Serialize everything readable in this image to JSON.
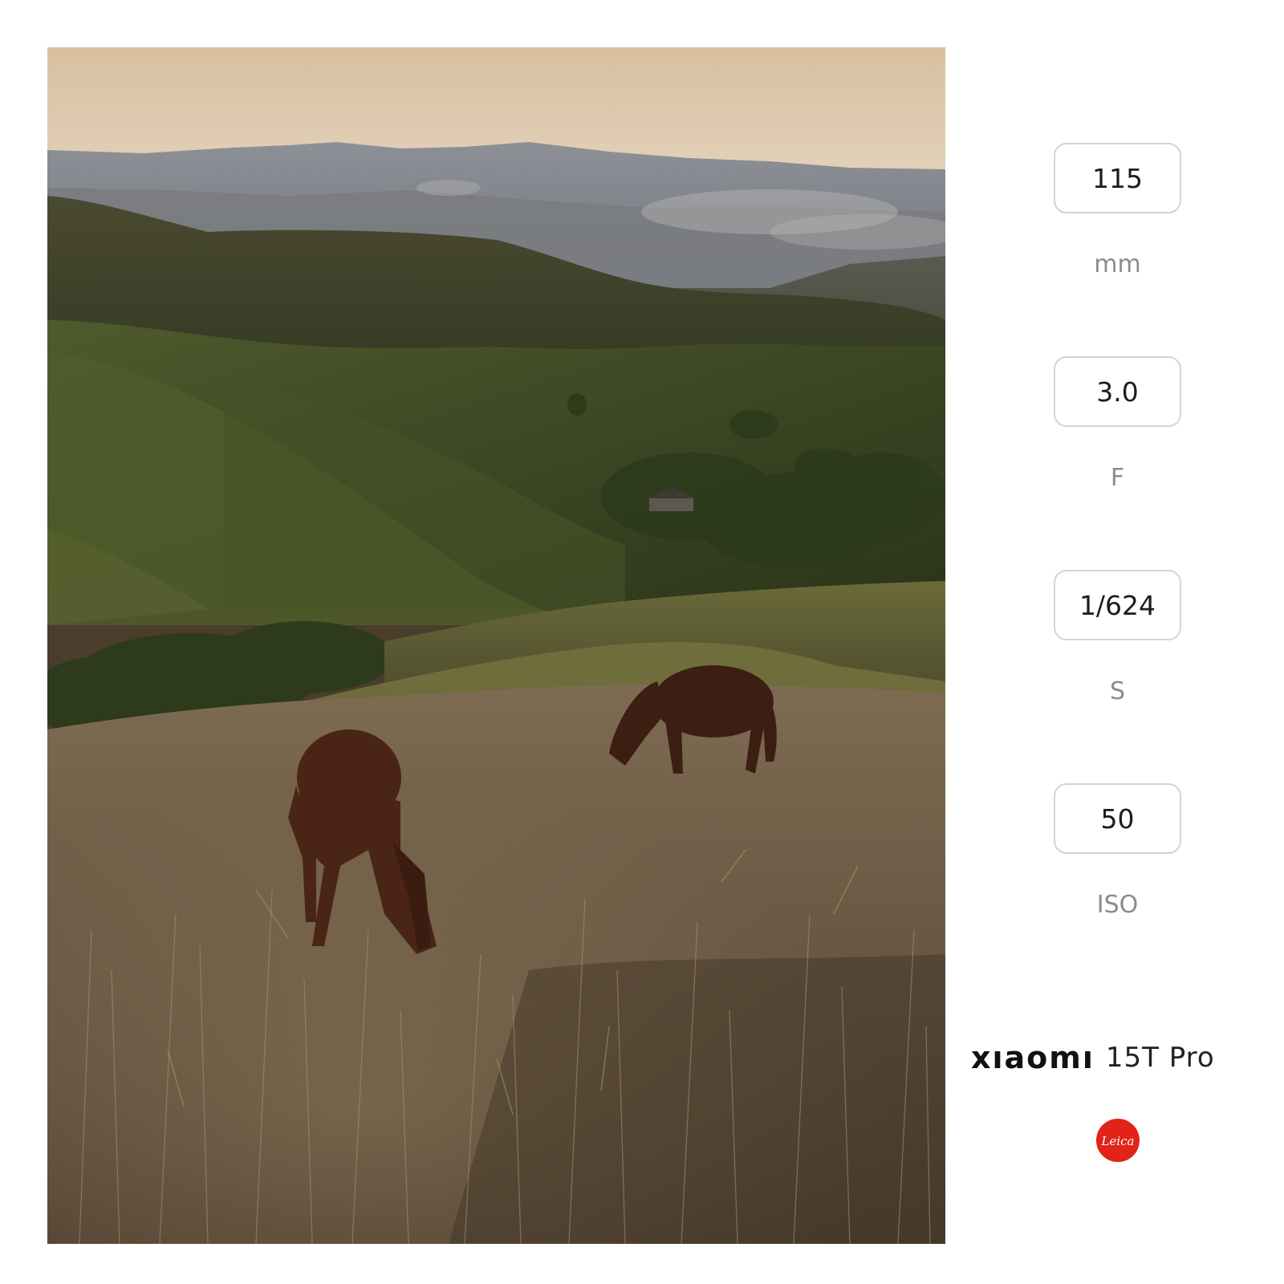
{
  "specs": [
    {
      "value": "115",
      "unit": "mm"
    },
    {
      "value": "3.0",
      "unit": "F"
    },
    {
      "value": "1/624",
      "unit": "S"
    },
    {
      "value": "50",
      "unit": "ISO"
    }
  ],
  "brand": {
    "name": "xıaomı",
    "model": "15T Pro",
    "logo": "Leica"
  },
  "colors": {
    "leica_red": "#e2231a",
    "sky_top": "#d7bfa1",
    "sky_low": "#e8d9c4",
    "hills": "#3d4224",
    "grass": "#6b5a44",
    "horse": "#4a2414"
  }
}
